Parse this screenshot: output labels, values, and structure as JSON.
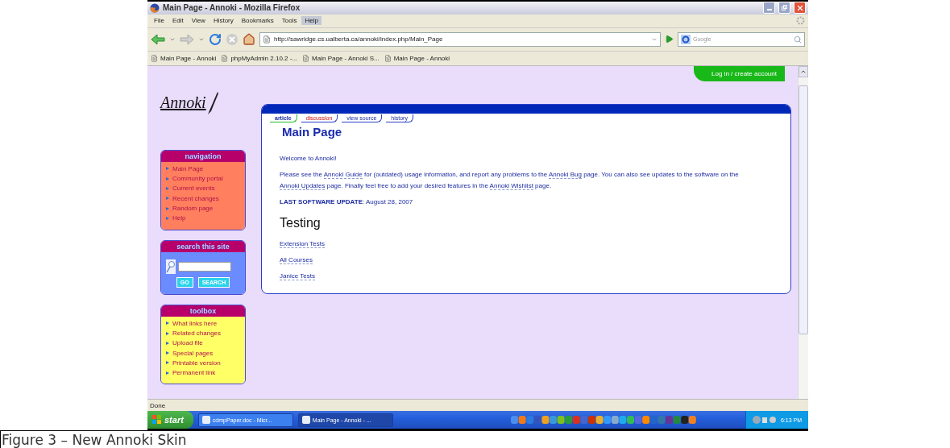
{
  "window": {
    "title": "Main Page - Annoki - Mozilla Firefox"
  },
  "menu": [
    {
      "label": "File",
      "selected": false
    },
    {
      "label": "Edit",
      "selected": false
    },
    {
      "label": "View",
      "selected": false
    },
    {
      "label": "History",
      "selected": false
    },
    {
      "label": "Bookmarks",
      "selected": false
    },
    {
      "label": "Tools",
      "selected": false
    },
    {
      "label": "Help",
      "selected": true
    }
  ],
  "address": {
    "url": "http://sawridge.cs.ualberta.ca/annoki/index.php/Main_Page"
  },
  "search_bar": {
    "placeholder": "Google"
  },
  "bookmarks": [
    "Main Page - Annoki",
    "phpMyAdmin 2.10.2 -...",
    "Main Page - Annoki S...",
    "Main Page - Annoki"
  ],
  "page": {
    "logo": "Annoki",
    "login": "Log in / create account",
    "sidebar": [
      {
        "kind": "links",
        "title": "navigation",
        "color": "#ff7f5f",
        "items": [
          "Main Page",
          "Community portal",
          "Current events",
          "Recent changes",
          "Random page",
          "Help"
        ]
      },
      {
        "kind": "search",
        "title": "search this site",
        "color": "#6b8cff",
        "buttons": [
          "GO",
          "SEARCH"
        ]
      },
      {
        "kind": "links",
        "title": "toolbox",
        "color": "#ffff66",
        "items": [
          "What links here",
          "Related changes",
          "Upload file",
          "Special pages",
          "Printable version",
          "Permanent link"
        ]
      }
    ],
    "tabs": [
      {
        "label": "article",
        "selected": true,
        "missing": false
      },
      {
        "label": "discussion",
        "selected": false,
        "missing": true
      },
      {
        "label": "view source",
        "selected": false,
        "missing": false
      },
      {
        "label": "history",
        "selected": false,
        "missing": false
      }
    ],
    "heading": "Main Page",
    "welcome": "Welcome to Annoki!",
    "intro": [
      {
        "text": "Please see the "
      },
      {
        "text": "Annoki Guide",
        "link": true
      },
      {
        "text": " for (outdated) usage information, and report any problems to the "
      },
      {
        "text": "Annoki Bug",
        "link": true
      },
      {
        "text": " page. You can also see updates to the software on the "
      },
      {
        "text": "Annoki Updates",
        "link": true
      },
      {
        "text": " page. Finally feel free to add your desired features in the "
      },
      {
        "text": "Annoki Wishlist",
        "link": true
      },
      {
        "text": " page."
      }
    ],
    "update": "**LAST SOFTWARE UPDATE**: August 28, 2007",
    "section": "Testing",
    "links": [
      "Extension Tests",
      "All Courses",
      "Janice Tests"
    ]
  },
  "status_bar": "Done",
  "taskbar": {
    "start": "start",
    "tasks": [
      {
        "label": "cdmpPaper.doc - Micr...",
        "selected": false
      },
      {
        "label": "Main Page - Annoki - ...",
        "selected": true
      }
    ],
    "clock": "6:13 PM"
  },
  "caption": "Figure 3 – New Annoki Skin"
}
